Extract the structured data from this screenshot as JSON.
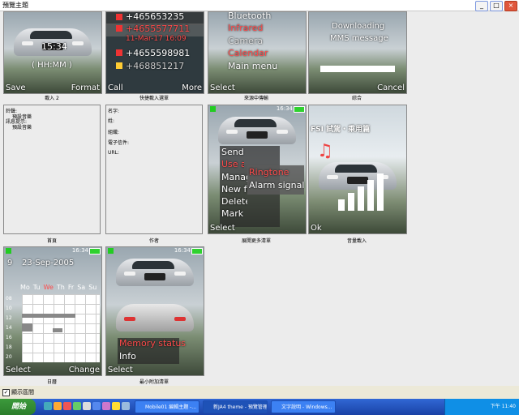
{
  "window": {
    "title": "預覽主題",
    "buttons": [
      "_",
      "□",
      "×"
    ]
  },
  "cells": {
    "c1": {
      "caption": "載入 2",
      "time_text": "15:34",
      "format_hint": "( HH:MM )",
      "soft_left": "Save",
      "soft_right": "Format"
    },
    "c2": {
      "caption": "快捷載入選單",
      "numbers": [
        "+465653235",
        "+4655577711",
        "11-Mar-17 16:09",
        "+4655598981",
        "+468851217"
      ],
      "soft_left": "Call",
      "soft_right": "More"
    },
    "c3": {
      "caption": "來源中傳輸",
      "items": [
        "Bluetooth",
        "Infrared",
        "Camera",
        "Calendar",
        "Main menu"
      ],
      "soft_left": "Select"
    },
    "c4": {
      "caption": "綜合",
      "lines": [
        "Downloading",
        "MMS message"
      ],
      "soft_right": "Cancel"
    },
    "c5": {
      "caption": "首頁",
      "lines": [
        "鈴聲:",
        "預設音樂",
        "訊息提示:",
        "預設音樂"
      ]
    },
    "c6": {
      "caption": "作者",
      "lines": [
        "名字:",
        "姓:",
        "組織:",
        "電子信件:",
        "URL:"
      ]
    },
    "c7": {
      "caption": "展開更多清單",
      "time": "16:34",
      "menu": [
        "Send",
        "Use as",
        "Manage",
        "New folder",
        "Delete",
        "Mark"
      ],
      "submenu": [
        "Ringtone",
        "Alarm signal"
      ],
      "soft_left": "Select"
    },
    "c8": {
      "caption": "音量載入",
      "header": "FSI 試駕・乘用篇",
      "soft_left": "Ok"
    },
    "c9": {
      "caption": "日曆",
      "time": "16:34",
      "date": "23-Sep-2005",
      "day_marker": "9",
      "weekdays": [
        "Mo",
        "Tu",
        "We",
        "Th",
        "Fr",
        "Sa",
        "Su"
      ],
      "hours": [
        "08",
        "10",
        "12",
        "14",
        "16",
        "18",
        "20"
      ],
      "soft_left": "Select",
      "soft_right": "Change"
    },
    "c10": {
      "caption": "最小附加清單",
      "time": "16:34",
      "items": [
        "Memory status",
        "Info"
      ],
      "soft_left": "Select"
    }
  },
  "checkbox": {
    "label": "顯示區間",
    "checked": true
  },
  "taskbar": {
    "start": "開始",
    "tasks": [
      "Mobile01 編輯主題 -...",
      "新JA4 theme - 預覽管理",
      "文字說明 - Windows..."
    ],
    "clock": "下午 11:40"
  },
  "colors": {
    "highlight": "#ff4b4b",
    "battery": "#2fd12f",
    "taskbar": "#245edb"
  }
}
